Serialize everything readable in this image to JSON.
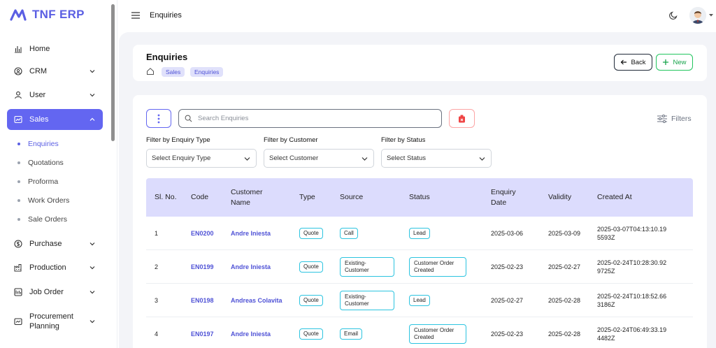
{
  "app": {
    "name": "TNF ERP",
    "brand_color": "#6366f1"
  },
  "topbar": {
    "title": "Enquiries"
  },
  "sidebar": {
    "items": [
      {
        "label": "Home",
        "icon": "chart-bars-icon",
        "has_children": false
      },
      {
        "label": "CRM",
        "icon": "crm-icon",
        "has_children": true
      },
      {
        "label": "User",
        "icon": "user-icon",
        "has_children": true
      },
      {
        "label": "Sales",
        "icon": "sales-icon",
        "has_children": true,
        "active": true
      },
      {
        "label": "Purchase",
        "icon": "dollar-icon",
        "has_children": true
      },
      {
        "label": "Production",
        "icon": "factory-icon",
        "has_children": true
      },
      {
        "label": "Job Order",
        "icon": "job-order-icon",
        "has_children": true
      },
      {
        "label": "Procurement Planning",
        "icon": "planning-icon",
        "has_children": true
      }
    ],
    "sales_sub": [
      "Enquiries",
      "Quotations",
      "Proforma",
      "Work Orders",
      "Sale Orders"
    ],
    "active_sub": "Enquiries"
  },
  "page": {
    "title": "Enquiries",
    "breadcrumbs": [
      "Sales",
      "Enquiries"
    ],
    "back_label": "Back",
    "new_label": "New"
  },
  "toolbar": {
    "search_placeholder": "Search Enquiries",
    "filters_label": "Filters"
  },
  "filters": [
    {
      "label": "Filter by Enquiry Type",
      "placeholder": "Select Enquiry Type"
    },
    {
      "label": "Filter by Customer",
      "placeholder": "Select Customer"
    },
    {
      "label": "Filter by Status",
      "placeholder": "Select Status"
    }
  ],
  "table": {
    "columns": [
      "Sl. No.",
      "Code",
      "Customer Name",
      "Type",
      "Source",
      "Status",
      "Enquiry Date",
      "Validity",
      "Created At"
    ],
    "rows": [
      {
        "sl": "1",
        "code": "EN0200",
        "customer": "Andre Iniesta",
        "type": "Quote",
        "source": "Call",
        "status": "Lead",
        "date": "2025-03-06",
        "validity": "2025-03-09",
        "created": "2025-03-07T04:13:10.195593Z"
      },
      {
        "sl": "2",
        "code": "EN0199",
        "customer": "Andre Iniesta",
        "type": "Quote",
        "source": "Existing-Customer",
        "status": "Customer Order Created",
        "date": "2025-02-23",
        "validity": "2025-02-27",
        "created": "2025-02-24T10:28:30.929725Z"
      },
      {
        "sl": "3",
        "code": "EN0198",
        "customer": "Andreas Colavita",
        "type": "Quote",
        "source": "Existing-Customer",
        "status": "Lead",
        "date": "2025-02-27",
        "validity": "2025-02-28",
        "created": "2025-02-24T10:18:52.663186Z"
      },
      {
        "sl": "4",
        "code": "EN0197",
        "customer": "Andre Iniesta",
        "type": "Quote",
        "source": "Email",
        "status": "Customer Order Created",
        "date": "2025-02-23",
        "validity": "2025-02-28",
        "created": "2025-02-24T06:49:33.194482Z"
      }
    ]
  }
}
